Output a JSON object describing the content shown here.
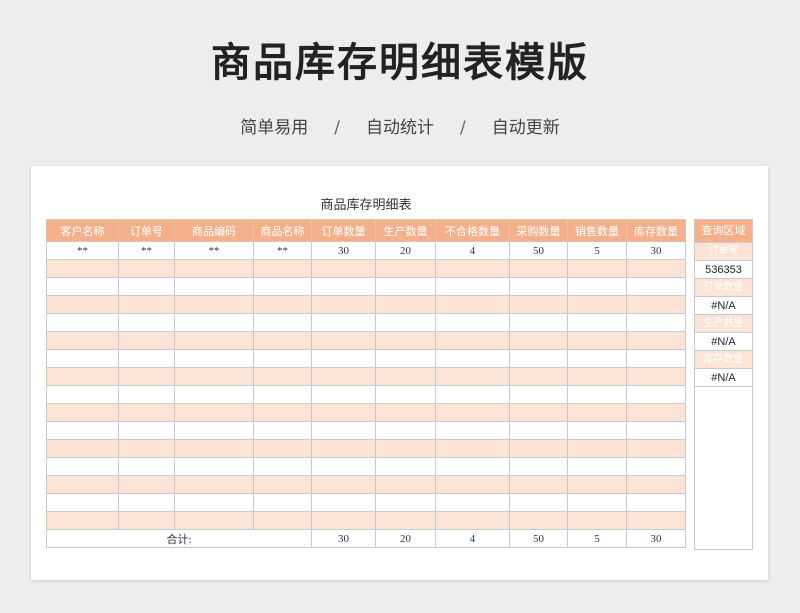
{
  "page": {
    "title": "商品库存明细表模版",
    "features": [
      "简单易用",
      "自动统计",
      "自动更新"
    ],
    "separator": "/"
  },
  "sheet": {
    "title": "商品库存明细表",
    "columns": [
      "客户名称",
      "订单号",
      "商品编码",
      "商品名称",
      "订单数量",
      "生产数量",
      "不合格数量",
      "采购数量",
      "销售数量",
      "库存数量"
    ],
    "first_row": [
      "**",
      "**",
      "**",
      "**",
      "30",
      "20",
      "4",
      "50",
      "5",
      "30"
    ],
    "total_label": "合计:",
    "totals": [
      "30",
      "20",
      "4",
      "50",
      "5",
      "30"
    ]
  },
  "query": {
    "header": "查询区域",
    "items": [
      {
        "label": "订单号",
        "value": "536353"
      },
      {
        "label": "订单数量",
        "value": "#N/A"
      },
      {
        "label": "生产数量",
        "value": "#N/A"
      },
      {
        "label": "库存数量",
        "value": "#N/A"
      }
    ]
  },
  "colors": {
    "header_bg": "#f4b08a",
    "stripe_bg": "#fce3d5"
  }
}
